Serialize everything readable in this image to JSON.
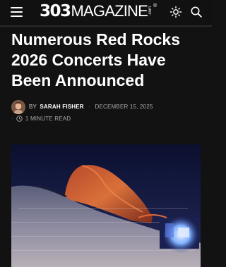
{
  "header": {
    "logo_number": "303",
    "logo_word": "MAGAZINE",
    "logo_dotcom": ".com",
    "logo_reg": "®",
    "icons": [
      "menu-icon",
      "sun-icon",
      "search-icon"
    ]
  },
  "article": {
    "headline": "Numerous Red Rocks 2026 Concerts Have Been Announced",
    "by_label": "BY",
    "author": "SARAH FISHER",
    "separator": "·",
    "date": "DECEMBER 15, 2025",
    "read_time": "1 MINUTE READ",
    "read_dot": "·"
  },
  "colors": {
    "background": "#121212",
    "text": "#ffffff"
  }
}
